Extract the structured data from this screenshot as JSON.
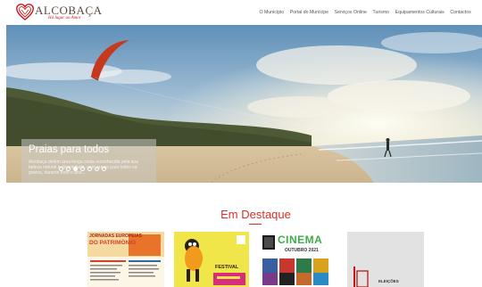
{
  "header": {
    "logo_name": "ALCOBAÇA",
    "logo_tagline": "Há lugar ao Amor",
    "nav": [
      "O Município",
      "Portal do Munícipe",
      "Serviços Online",
      "Turismo",
      "Equipamentos Culturais",
      "Contactos"
    ]
  },
  "hero": {
    "title": "Praias para todos",
    "text": "Alcobaça detém uma longa costa reconhecida pela sua beleza natural e diversidade, com praias para todos os gostos, durante todo o ano...",
    "slide_count": 7,
    "active_slide": 3
  },
  "featured": {
    "title": "Em Destaque",
    "cards": [
      {
        "line1": "JORNADAS EUROPEIAS",
        "line2": "DO PATRIMÓNIO"
      },
      {
        "line1": "FESTIVAL"
      },
      {
        "line1": "CINEMA",
        "line2": "OUTUBRO 2021"
      },
      {
        "line1": "ELEIÇÕES"
      }
    ]
  },
  "colors": {
    "accent": "#d6302a",
    "brand": "#c4161c"
  },
  "icons": [
    "heart-logo-icon"
  ]
}
